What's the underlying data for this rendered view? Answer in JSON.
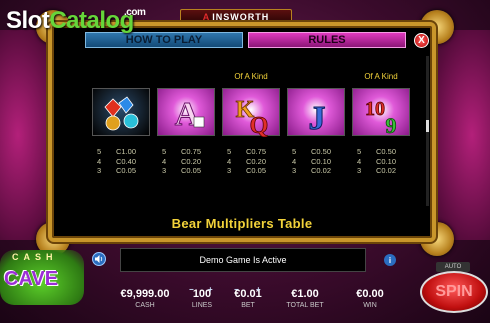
{
  "watermark": {
    "slot": "Slot",
    "catalog": "Catalog",
    "com": ".com"
  },
  "brand": {
    "mark": "A",
    "name": "INSWORTH"
  },
  "tabs": {
    "how_to_play": "HOW TO PLAY",
    "rules": "RULES"
  },
  "close_label": "X",
  "symbols": [
    {
      "name": "gems",
      "header": "",
      "pays": [
        [
          "5",
          "C1.00"
        ],
        [
          "4",
          "C0.40"
        ],
        [
          "3",
          "C0.05"
        ]
      ]
    },
    {
      "name": "A",
      "header": "",
      "pays": [
        [
          "5",
          "C0.75"
        ],
        [
          "4",
          "C0.20"
        ],
        [
          "3",
          "C0.05"
        ]
      ]
    },
    {
      "name": "KQ",
      "header": "Of A Kind",
      "pays": [
        [
          "5",
          "C0.75"
        ],
        [
          "4",
          "C0.20"
        ],
        [
          "3",
          "C0.05"
        ]
      ]
    },
    {
      "name": "J",
      "header": "",
      "pays": [
        [
          "5",
          "C0.50"
        ],
        [
          "4",
          "C0.10"
        ],
        [
          "3",
          "C0.02"
        ]
      ]
    },
    {
      "name": "109",
      "header": "Of A Kind",
      "pays": [
        [
          "5",
          "C0.50"
        ],
        [
          "4",
          "C0.10"
        ],
        [
          "3",
          "C0.02"
        ]
      ]
    }
  ],
  "table_title": "Bear Multipliers Table",
  "game_logo": {
    "top": "CASH",
    "main": "CAVE"
  },
  "message": "Demo Game Is Active",
  "auto_label": "AUTO",
  "spin_label": "SPIN",
  "stats": {
    "cash": {
      "value": "€9,999.00",
      "label": "CASH"
    },
    "lines": {
      "value": "100",
      "label": "LINES"
    },
    "bet": {
      "value": "€0.01",
      "label": "BET"
    },
    "total_bet": {
      "value": "€1.00",
      "label": "TOTAL BET"
    },
    "win": {
      "value": "€0.00",
      "label": "WIN"
    }
  },
  "colors": {
    "frame_gold": "#c9962b",
    "tab_blue": "#2f76ad",
    "tab_pink": "#e03ac0",
    "title_yellow": "#f2d23a",
    "spin_red": "#c00f0f"
  }
}
